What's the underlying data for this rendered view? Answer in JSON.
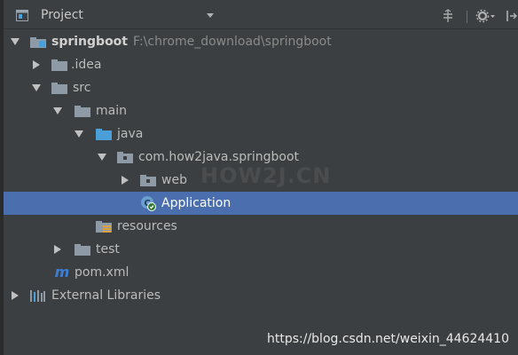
{
  "header": {
    "title": "Project",
    "icons": [
      "project-view-icon",
      "dropdown-arrow-icon",
      "collapse-all-icon",
      "settings-gear-icon",
      "hide-panel-icon"
    ]
  },
  "tree": {
    "root": {
      "label": "springboot",
      "path": "F:\\chrome_download\\springboot"
    },
    "idea": "idea",
    "src": "src",
    "main": "main",
    "java": "java",
    "package": "com.how2java.springboot",
    "web": "web",
    "application": "Application",
    "resources": "resources",
    "test": "test",
    "pom": "pom.xml",
    "external": "External Libraries"
  },
  "selected_item": "Application",
  "watermark": "HOW2J.CN",
  "credit": "https://blog.csdn.net/weixin_44624410",
  "colors": {
    "background": "#3c3f41",
    "selection": "#4b6eaf",
    "folder": "#8e9aa6",
    "source_folder": "#4a9fd8",
    "maven_icon": "#3c7ed4"
  }
}
